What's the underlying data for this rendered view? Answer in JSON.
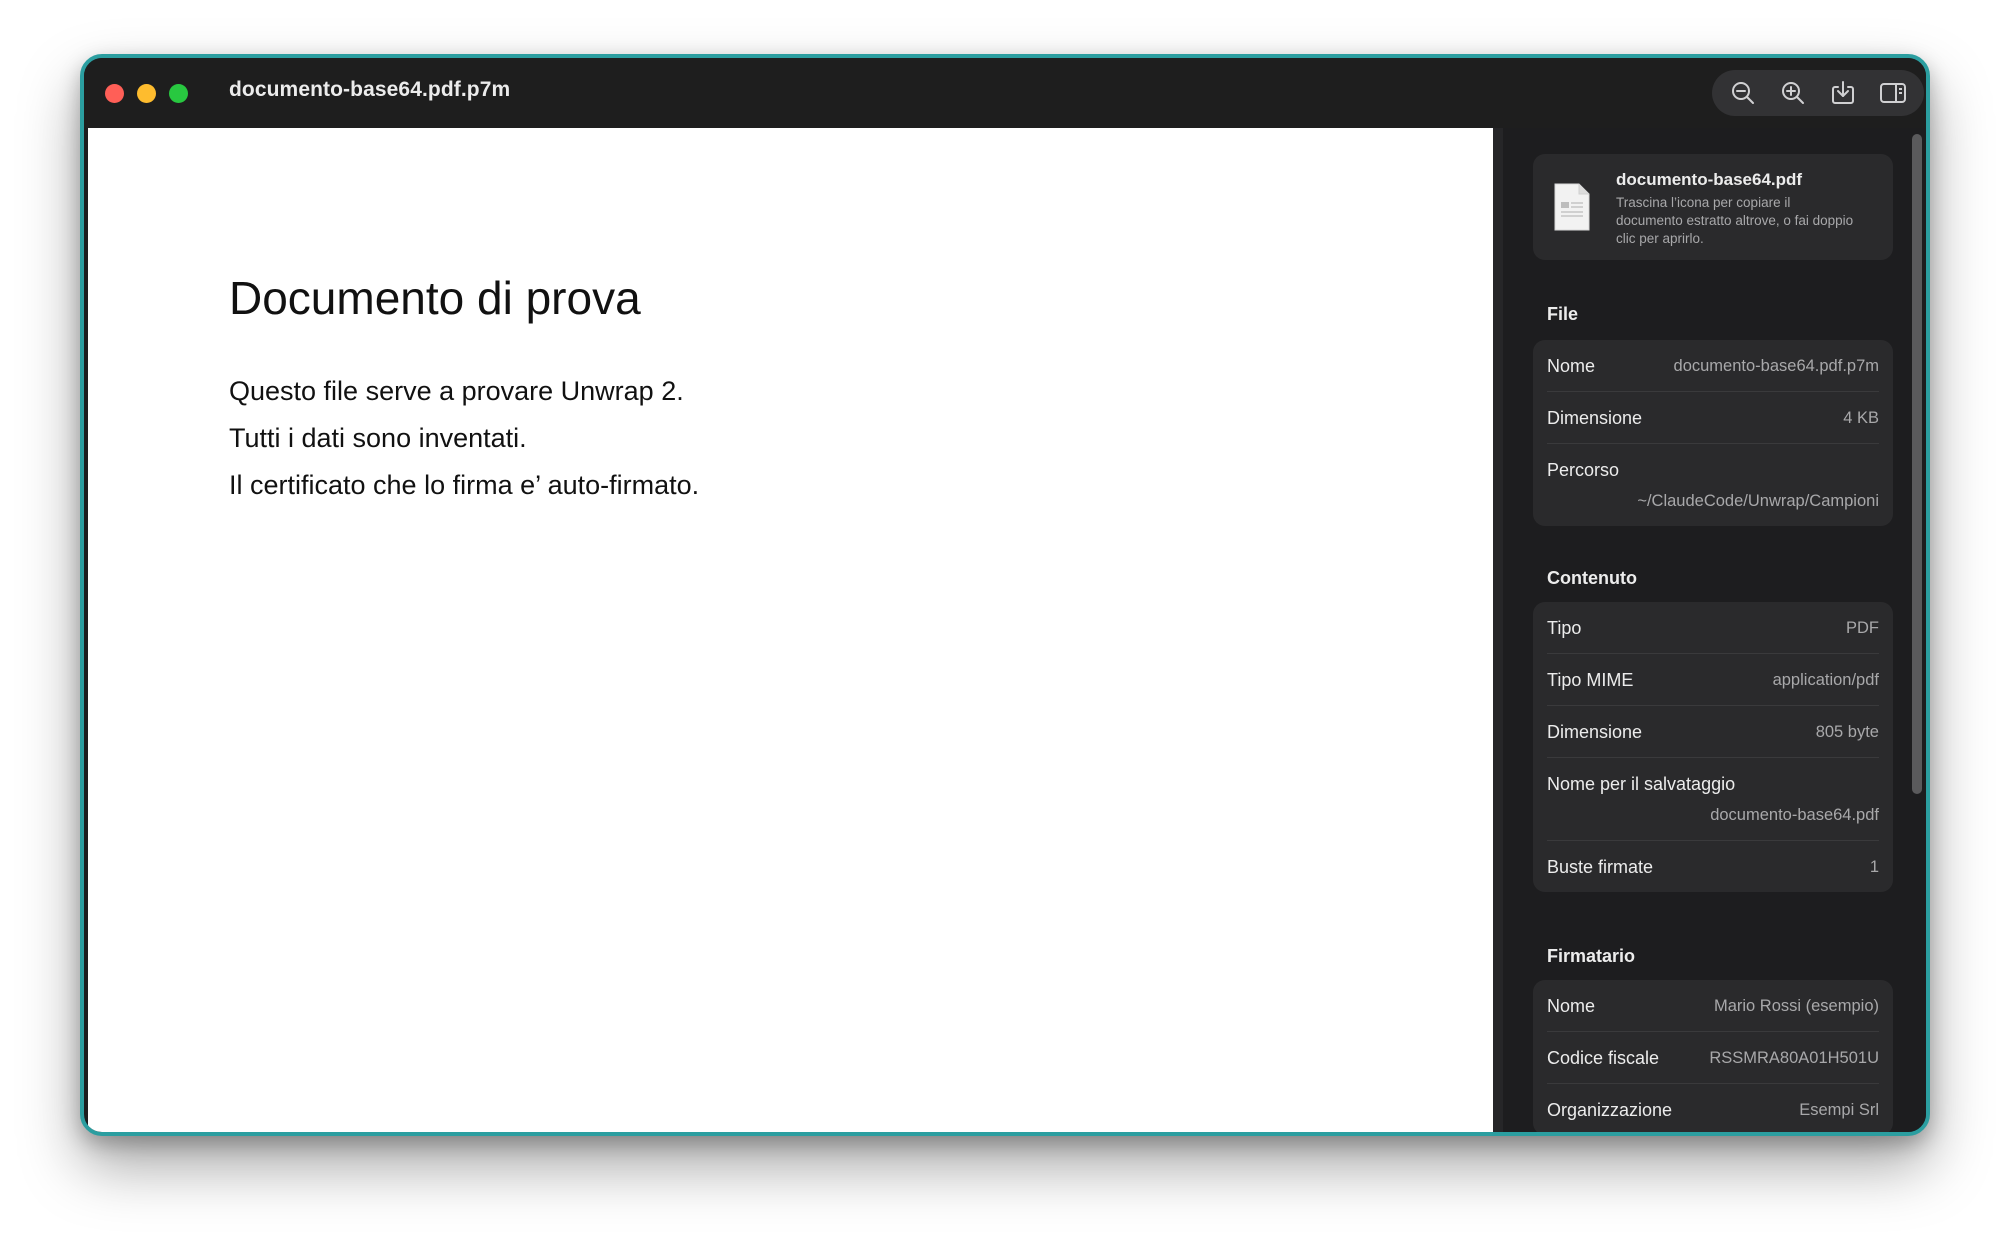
{
  "window": {
    "title": "documento-base64.pdf.p7m"
  },
  "toolbar": {
    "icons": [
      "zoom-out-icon",
      "zoom-in-icon",
      "save-download-icon",
      "sidebar-toggle-icon"
    ]
  },
  "document": {
    "heading": "Documento di prova",
    "lines": [
      "Questo file serve a provare Unwrap 2.",
      "Tutti i dati sono inventati.",
      "Il certificato che lo firma e’ auto-firmato."
    ]
  },
  "extracted": {
    "name": "documento-base64.pdf",
    "hint": "Trascina l’icona per copiare il documento estratto altrove, o fai doppio clic per aprirlo."
  },
  "sections": {
    "file": {
      "title": "File",
      "rows": [
        {
          "key": "Nome",
          "value": "documento-base64.pdf.p7m"
        },
        {
          "key": "Dimensione",
          "value": "4 KB"
        },
        {
          "key": "Percorso",
          "value": "~/ClaudeCode/Unwrap/Campioni"
        }
      ]
    },
    "content": {
      "title": "Contenuto",
      "rows": [
        {
          "key": "Tipo",
          "value": "PDF"
        },
        {
          "key": "Tipo MIME",
          "value": "application/pdf"
        },
        {
          "key": "Dimensione",
          "value": "805 byte"
        },
        {
          "key": "Nome per il salvataggio",
          "value": "documento-base64.pdf"
        },
        {
          "key": "Buste firmate",
          "value": "1"
        }
      ]
    },
    "signer": {
      "title": "Firmatario",
      "rows": [
        {
          "key": "Nome",
          "value": "Mario Rossi (esempio)"
        },
        {
          "key": "Codice fiscale",
          "value": "RSSMRA80A01H501U"
        },
        {
          "key": "Organizzazione",
          "value": "Esempi Srl"
        }
      ]
    }
  },
  "colors": {
    "window_border": "#2b9ea0",
    "sidebar_bg": "#1d1d1f",
    "card_bg": "#2a2a2c"
  }
}
